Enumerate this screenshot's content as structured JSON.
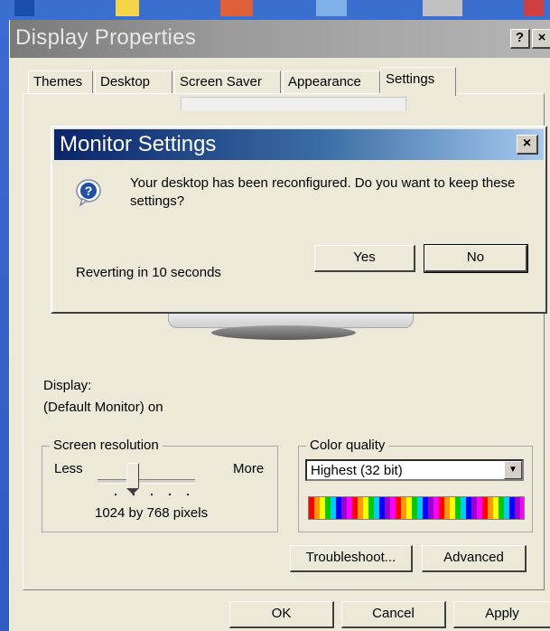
{
  "window": {
    "title": "Display Properties",
    "help_glyph": "?",
    "close_glyph": "×"
  },
  "tabs": [
    {
      "label": "Themes"
    },
    {
      "label": "Desktop"
    },
    {
      "label": "Screen Saver"
    },
    {
      "label": "Appearance"
    },
    {
      "label": "Settings",
      "active": true
    }
  ],
  "settings": {
    "display_label": "Display:",
    "display_value": "(Default Monitor) on",
    "resolution": {
      "group_title": "Screen resolution",
      "less_label": "Less",
      "more_label": "More",
      "value_text": "1024 by 768 pixels",
      "slider_level": 0.3
    },
    "color_quality": {
      "group_title": "Color quality",
      "selected": "Highest (32 bit)"
    },
    "troubleshoot_label": "Troubleshoot...",
    "advanced_label": "Advanced"
  },
  "footer": {
    "ok_label": "OK",
    "cancel_label": "Cancel",
    "apply_label": "Apply"
  },
  "dialog": {
    "title": "Monitor Settings",
    "close_glyph": "×",
    "message": "Your desktop has been reconfigured.  Do you want to keep these settings?",
    "status": "Reverting in 10 seconds",
    "yes_label": "Yes",
    "no_label": "No",
    "icon": "question-icon"
  },
  "colors": {
    "dialog_title_start": "#0a246a",
    "dialog_title_end": "#a6caf0",
    "window_title_inactive": "#9b9b9b",
    "face": "#ece9d8"
  }
}
